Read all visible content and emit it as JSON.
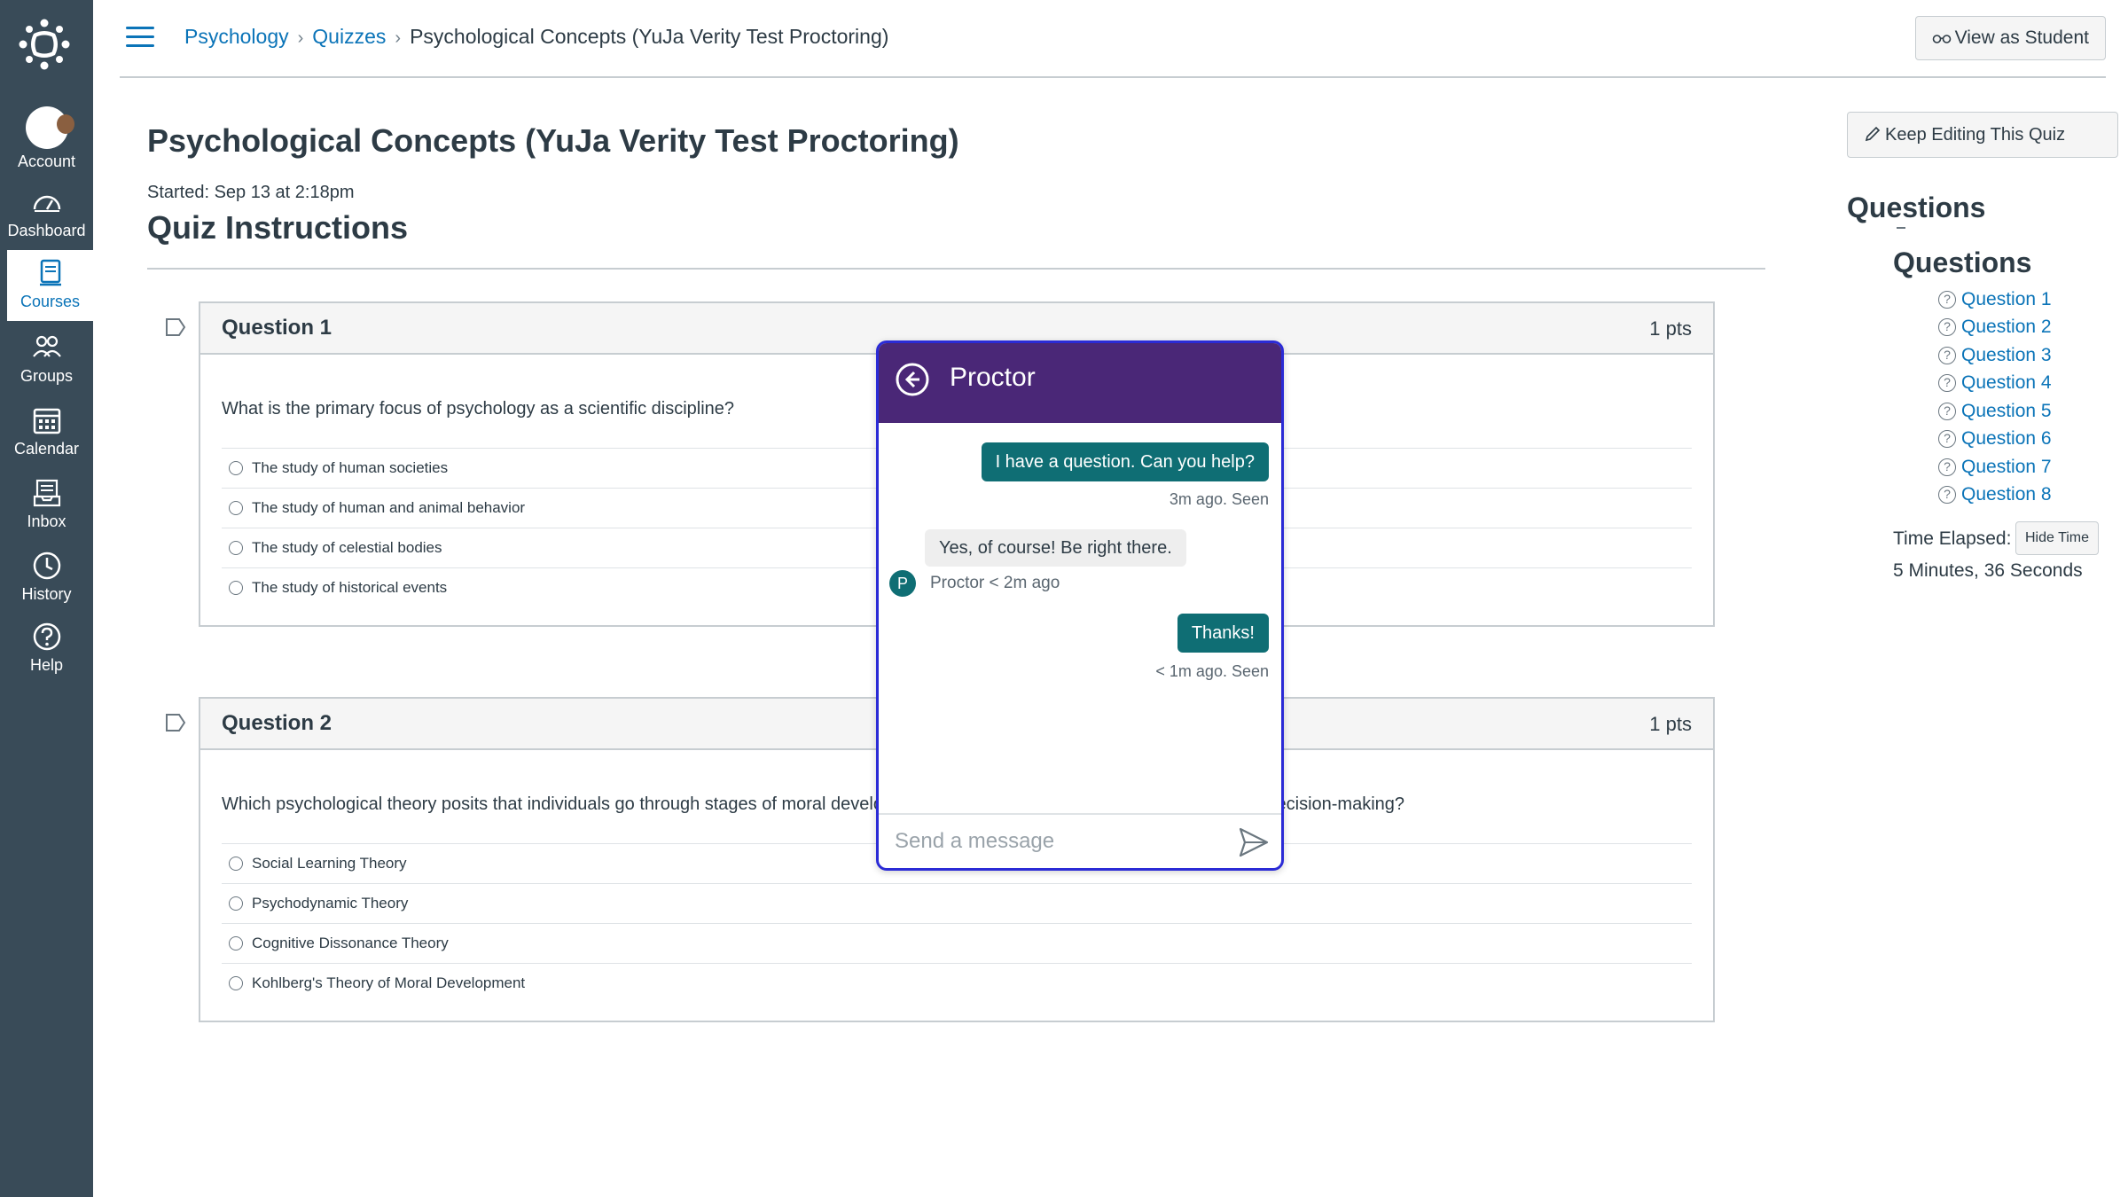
{
  "nav": {
    "items": [
      {
        "label": "Account",
        "icon": "avatar"
      },
      {
        "label": "Dashboard",
        "icon": "dashboard-icon"
      },
      {
        "label": "Courses",
        "icon": "courses-icon",
        "active": true
      },
      {
        "label": "Groups",
        "icon": "groups-icon"
      },
      {
        "label": "Calendar",
        "icon": "calendar-icon"
      },
      {
        "label": "Inbox",
        "icon": "inbox-icon"
      },
      {
        "label": "History",
        "icon": "history-icon"
      },
      {
        "label": "Help",
        "icon": "help-icon"
      }
    ]
  },
  "breadcrumb": {
    "items": [
      "Psychology",
      "Quizzes"
    ],
    "current": "Psychological Concepts (YuJa Verity Test Proctoring)"
  },
  "header": {
    "view_as_student": "View as Student"
  },
  "quiz": {
    "title": "Psychological Concepts (YuJa Verity Test Proctoring)",
    "started": "Started: Sep 13 at 2:18pm",
    "instructions_heading": "Quiz Instructions",
    "questions": [
      {
        "name": "Question 1",
        "points": "1 pts",
        "text": "What is the primary focus of psychology as a scientific discipline?",
        "answers": [
          "The study of human societies",
          "The study of human and animal behavior",
          "The study of celestial bodies",
          "The study of historical events"
        ]
      },
      {
        "name": "Question 2",
        "points": "1 pts",
        "text": "Which psychological theory posits that individuals go through stages of moral development, from a focus on self-interest to principled decision-making?",
        "answers": [
          "Social Learning Theory",
          "Psychodynamic Theory",
          "Cognitive Dissonance Theory",
          "Kohlberg's Theory of Moral Development"
        ]
      }
    ]
  },
  "sidebar": {
    "keep_editing": "Keep Editing This Quiz",
    "heading": "Questions",
    "subheading": "Questions",
    "question_links": [
      "Question 1",
      "Question 2",
      "Question 3",
      "Question 4",
      "Question 5",
      "Question 6",
      "Question 7",
      "Question 8"
    ],
    "time_elapsed_label": "Time Elapsed:",
    "hide_time": "Hide Time",
    "time_elapsed_value": "5 Minutes, 36 Seconds"
  },
  "chat": {
    "title": "Proctor",
    "messages": [
      {
        "from": "me",
        "text": "I have a question. Can you help?",
        "meta": "3m ago. Seen"
      },
      {
        "from": "proctor",
        "text": "Yes, of course! Be right there.",
        "meta": "Proctor <  2m ago",
        "avatar_letter": "P"
      },
      {
        "from": "me",
        "text": "Thanks!",
        "meta": "< 1m ago. Seen"
      }
    ],
    "input_placeholder": "Send a message"
  },
  "colors": {
    "nav_bg": "#394b58",
    "link": "#0b74b8",
    "chat_header": "#4a2777",
    "chat_bubble": "#0f6e74",
    "chat_border": "#2b2bd6"
  }
}
